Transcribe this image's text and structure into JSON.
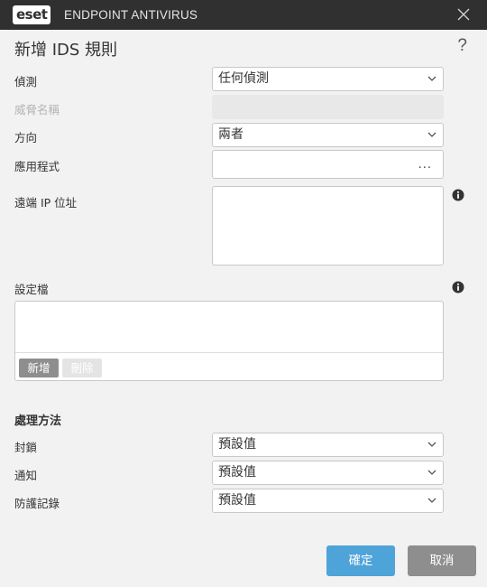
{
  "window": {
    "brand": "eset",
    "product": "ENDPOINT ANTIVIRUS"
  },
  "dialog": {
    "title": "新增 IDS 規則",
    "help": "?"
  },
  "fields": {
    "detection": {
      "label": "偵測",
      "value": "任何偵測"
    },
    "threat_name": {
      "label": "威脅名稱",
      "value": ""
    },
    "direction": {
      "label": "方向",
      "value": "兩者"
    },
    "application": {
      "label": "應用程式",
      "value": "",
      "browse": "..."
    },
    "remote_ip": {
      "label": "遠端 IP 位址",
      "value": ""
    }
  },
  "profiles": {
    "label": "設定檔",
    "add_label": "新增",
    "delete_label": "刪除"
  },
  "action": {
    "section_title": "處理方法",
    "block": {
      "label": "封鎖",
      "value": "預設值"
    },
    "notify": {
      "label": "通知",
      "value": "預設值"
    },
    "log": {
      "label": "防護記錄",
      "value": "預設值"
    }
  },
  "buttons": {
    "ok": "確定",
    "cancel": "取消"
  },
  "colors": {
    "titlebar": "#303030",
    "primary": "#4ea3d8",
    "secondary": "#8e8e8e",
    "background": "#f2f2f2"
  },
  "icons": [
    "close-icon",
    "chevron-down-icon",
    "info-icon"
  ]
}
